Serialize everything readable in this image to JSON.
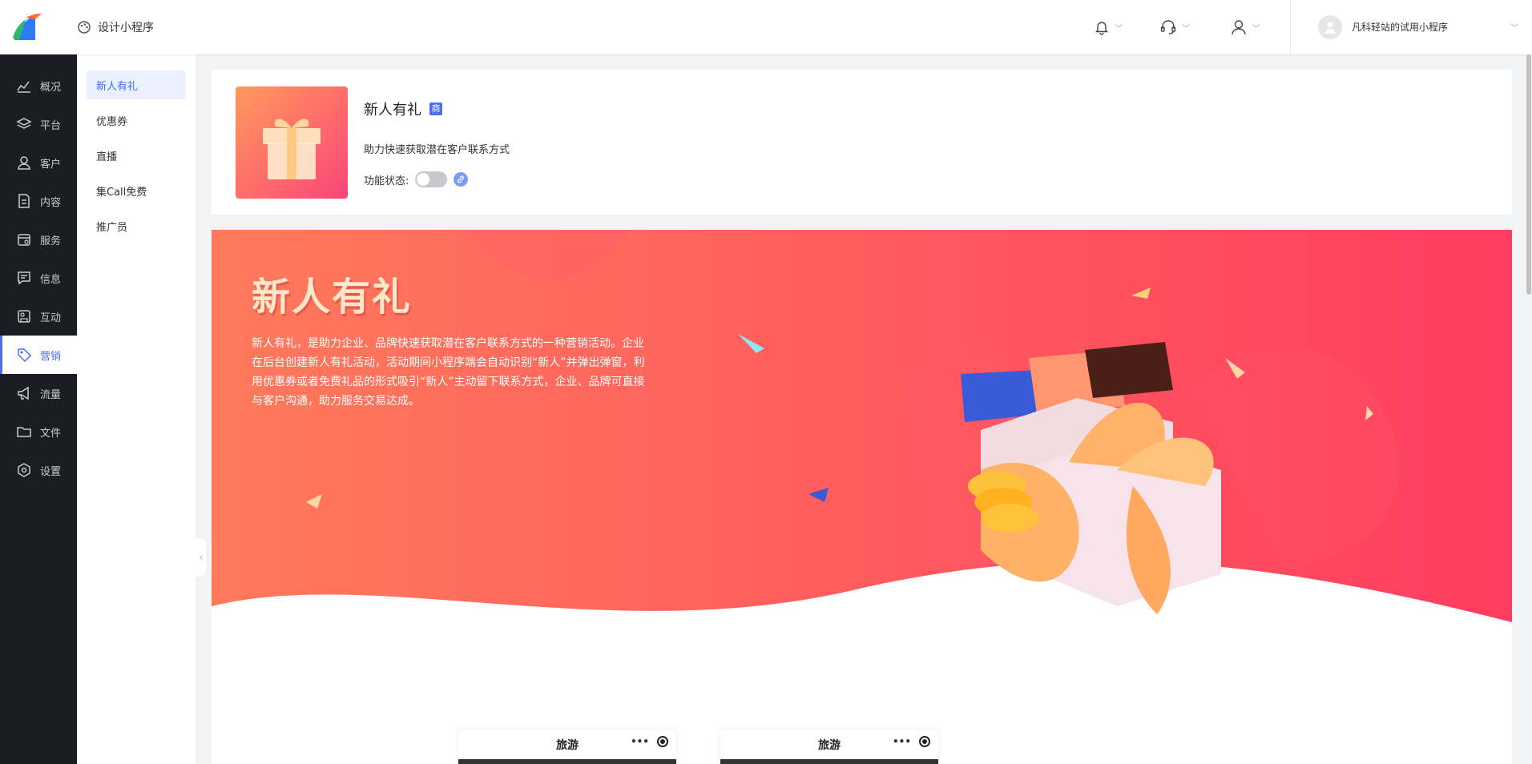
{
  "header": {
    "design_label": "设计小程序",
    "account_name": "凡科轻站的试用小程序"
  },
  "sidebar": {
    "items": [
      {
        "label": "概况",
        "icon": "chart-icon"
      },
      {
        "label": "平台",
        "icon": "layers-icon"
      },
      {
        "label": "客户",
        "icon": "user-icon"
      },
      {
        "label": "内容",
        "icon": "document-icon"
      },
      {
        "label": "服务",
        "icon": "calendar-icon"
      },
      {
        "label": "信息",
        "icon": "message-icon"
      },
      {
        "label": "互动",
        "icon": "interaction-icon"
      },
      {
        "label": "营销",
        "icon": "tag-icon"
      },
      {
        "label": "流量",
        "icon": "megaphone-icon"
      },
      {
        "label": "文件",
        "icon": "folder-icon"
      },
      {
        "label": "设置",
        "icon": "gear-icon"
      }
    ],
    "active": "营销"
  },
  "submenu": {
    "items": [
      "新人有礼",
      "优惠券",
      "直播",
      "集Call免费",
      "推广员"
    ],
    "active": "新人有礼"
  },
  "feature_card": {
    "title": "新人有礼",
    "badge": "商",
    "description": "助力快速获取潜在客户联系方式",
    "status_label": "功能状态:",
    "enabled": false
  },
  "banner": {
    "title": "新人有礼",
    "description": "新人有礼，是助力企业、品牌快速获取潜在客户联系方式的一种营销活动。企业在后台创建新人有礼活动，活动期间小程序端会自动识别“新人”并弹出弹窗，利用优惠券或者免费礼品的形式吸引“新人”主动留下联系方式，企业、品牌可直接与客户沟通，助力服务交易达成。"
  },
  "previews": [
    {
      "title": "旅游"
    },
    {
      "title": "旅游"
    }
  ],
  "colors": {
    "accent": "#4c6ef5",
    "sidebar_bg": "#1c1d22",
    "banner_start": "#ff7a5c",
    "banner_end": "#ff3d5f"
  }
}
